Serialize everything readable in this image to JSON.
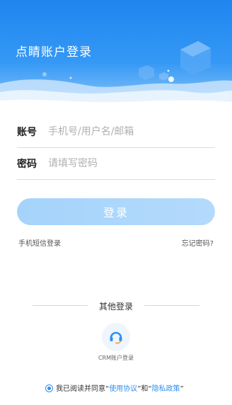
{
  "header": {
    "title": "点睛账户登录"
  },
  "form": {
    "account_label": "账号",
    "account_placeholder": "手机号/用户名/邮箱",
    "account_value": "",
    "password_label": "密码",
    "password_placeholder": "请填写密码",
    "password_value": ""
  },
  "actions": {
    "login_label": "登录",
    "sms_login_label": "手机短信登录",
    "forgot_password_label": "忘记密码?"
  },
  "other_login": {
    "title": "其他登录",
    "crm_label": "CRM账户登录",
    "crm_icon": "headset-icon"
  },
  "agreement": {
    "checked": true,
    "prefix": "我已阅读并同意",
    "quote_open_1": "“",
    "terms_label": "使用协议",
    "quote_close_1": "”",
    "and_text": "和",
    "quote_open_2": "“",
    "privacy_label": "隐私政策",
    "quote_close_2": "”"
  },
  "colors": {
    "brand_blue": "#2f8ff0",
    "header_top": "#1f86f0",
    "login_button": "#a5d3fb"
  }
}
